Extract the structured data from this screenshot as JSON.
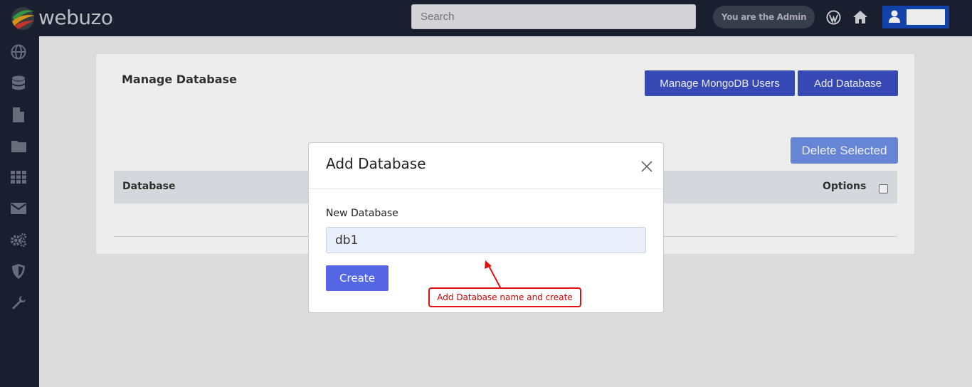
{
  "app": {
    "logo_text": "webuzo"
  },
  "topbar": {
    "search_placeholder": "Search",
    "admin_label": "You are the Admin",
    "icons": [
      "wordpress-icon",
      "home-icon",
      "user-icon"
    ]
  },
  "sidebar": {
    "icons": [
      "globe-icon",
      "database-icon",
      "file-icon",
      "folder-icon",
      "grid-icon",
      "mail-icon",
      "gears-icon",
      "shield-icon",
      "wrench-icon"
    ]
  },
  "page": {
    "title": "Manage Database",
    "manage_mongodb_label": "Manage MongoDB Users",
    "add_database_label": "Add Database",
    "delete_selected_label": "Delete Selected",
    "table": {
      "columns": [
        "Database",
        "Options"
      ]
    }
  },
  "modal": {
    "title": "Add Database",
    "field_label": "New Database",
    "field_value": "db1",
    "create_label": "Create"
  },
  "annotation": {
    "text": "Add Database name and create"
  },
  "colors": {
    "topbar_bg": "#1c2233",
    "primary_button": "#3a4ec2",
    "create_button": "#5566e4",
    "annotation": "#e01010"
  }
}
